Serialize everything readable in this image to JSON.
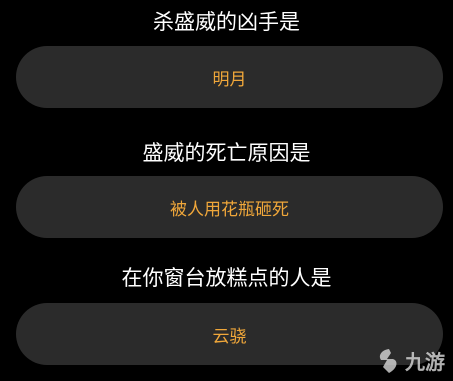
{
  "quiz": {
    "items": [
      {
        "question": "杀盛威的凶手是",
        "answer": "明月"
      },
      {
        "question": "盛威的死亡原因是",
        "answer": "被人用花瓶砸死"
      },
      {
        "question": "在你窗台放糕点的人是",
        "answer": "云骁"
      }
    ]
  },
  "watermark": {
    "text": "九游",
    "icon": "jiuyou-logo-icon"
  },
  "colors": {
    "background": "#000000",
    "answer_bg": "#2b2b2b",
    "answer_text": "#f0a73a",
    "question_text": "#ffffff"
  }
}
